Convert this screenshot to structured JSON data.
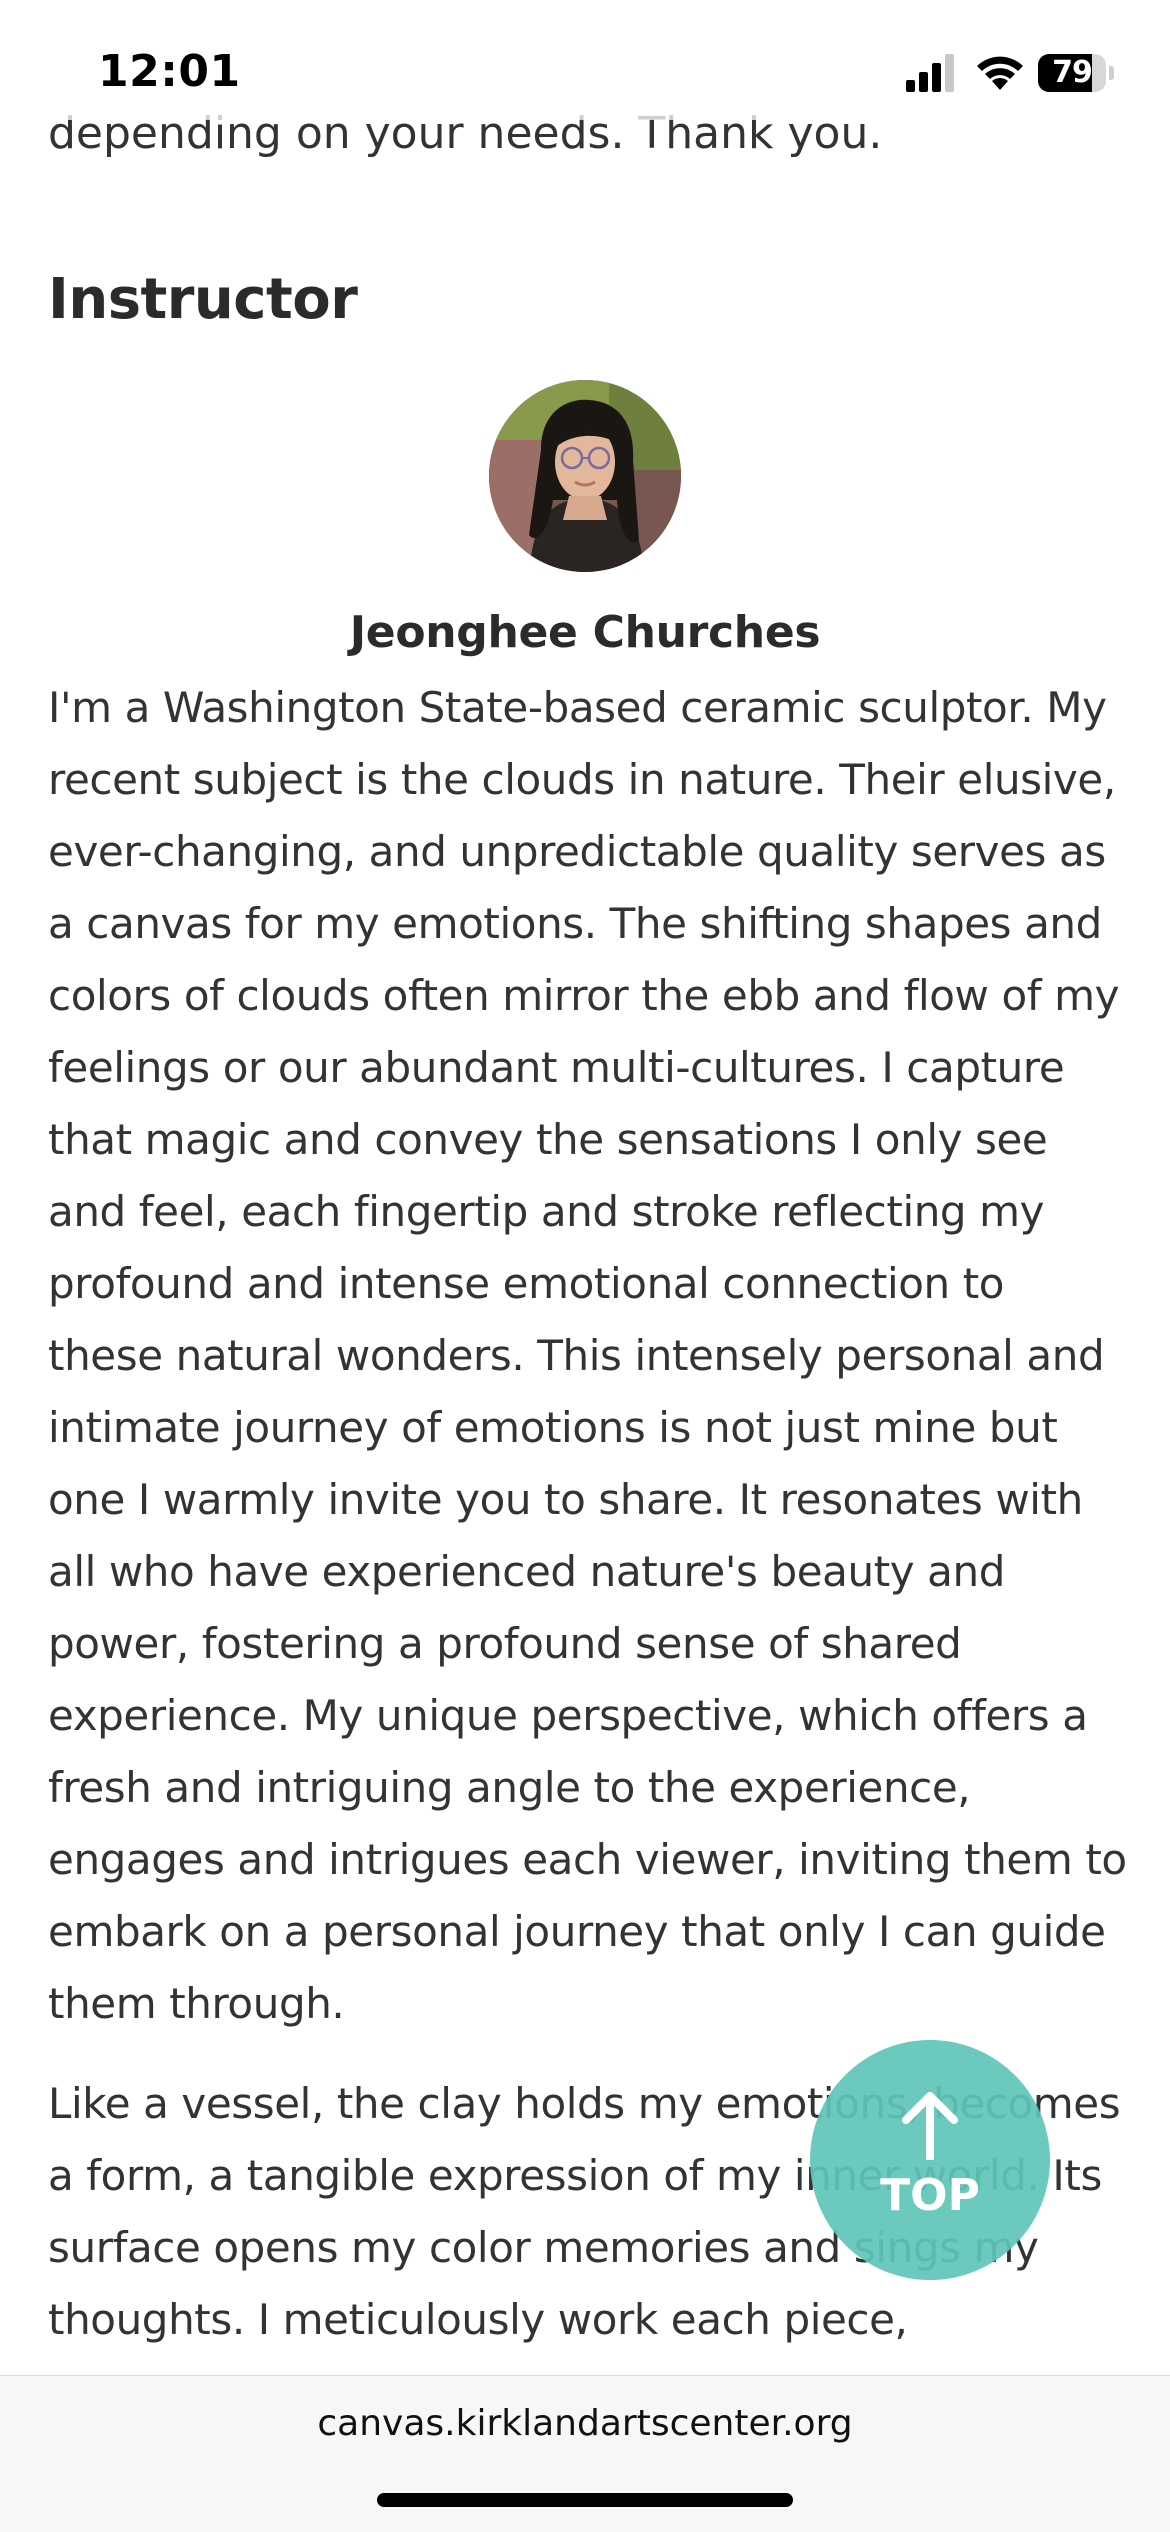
{
  "status_bar": {
    "time": "12:01",
    "battery_level": "79",
    "battery_fraction": 0.79,
    "icons": [
      "signal-icon",
      "wifi-icon",
      "battery-icon"
    ]
  },
  "page": {
    "partial_line_top": "depending on your needs. Thank you.",
    "section_heading": "Instructor",
    "instructor_name": "Jeonghee Churches",
    "bio_paragraph_1": "I'm a Washington State-based ceramic sculptor. My recent subject is the clouds in nature. Their elusive, ever-changing, and unpredictable quality serves as a canvas for my emotions. The shifting shapes and colors of clouds often mirror the ebb and flow of my feelings or our abundant multi-cultures. I capture that magic and convey the sensations I only see and feel, each fingertip and stroke reflecting my profound and intense emotional connection to these natural wonders. This intensely personal and intimate journey of emotions is not just mine but one I warmly invite you to share. It resonates with all who have experienced nature's beauty and power, fostering a profound sense of shared experience. My unique perspective, which offers a fresh and intriguing angle to the experience, engages and intrigues each viewer, inviting them to embark on a personal journey that only I can guide them through.",
    "bio_paragraph_2": "Like a vessel, the clay holds my emotions, becomes a form, a tangible expression of my inner world. Its surface opens my color memories and sings my thoughts. I meticulously work each piece,"
  },
  "top_button": {
    "label": "TOP",
    "icon": "arrow-up-icon",
    "color": "#5ec4b9"
  },
  "browser": {
    "url": "canvas.kirklandartscenter.org"
  }
}
